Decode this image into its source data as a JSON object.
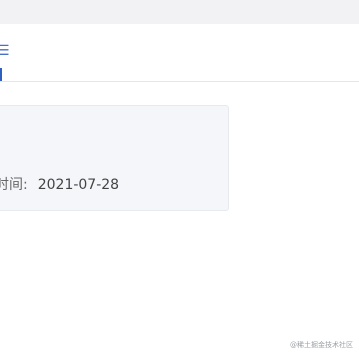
{
  "nav": {
    "icon": "menu-lines-icon",
    "icon_glyph": "☰"
  },
  "card": {
    "label": "时间",
    "separator": ":",
    "value": "2021-07-28"
  },
  "watermark": {
    "text": "@稀土掘金技术社区"
  },
  "colors": {
    "top_strip": "#f2f2f4",
    "accent": "#2f5fbf",
    "card_bg": "#f4f6f9",
    "text": "#444444"
  }
}
